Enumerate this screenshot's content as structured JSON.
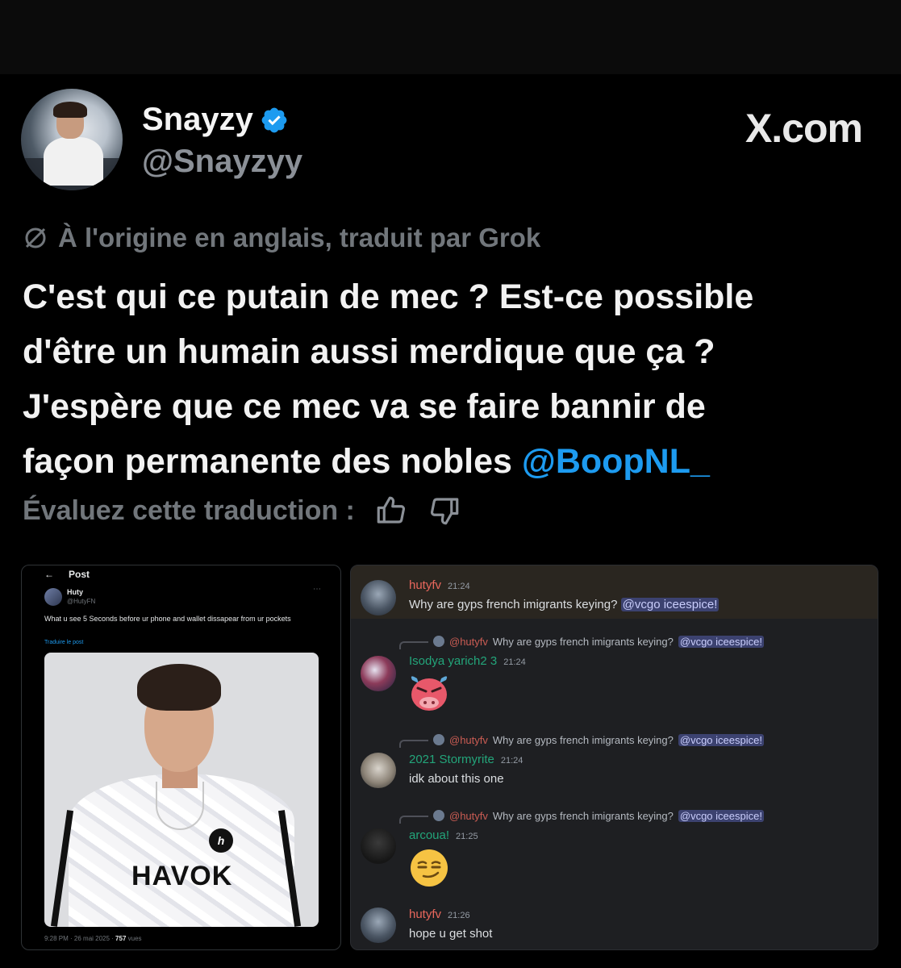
{
  "header": {
    "display_name": "Snayzy",
    "handle": "@Snayzyy",
    "brand": "X.com"
  },
  "translation": {
    "note": "À l'origine en anglais, traduit par Grok",
    "rate_label": "Évaluez cette traduction :"
  },
  "tweet": {
    "line1": "C'est qui ce putain de mec ? Est-ce possible",
    "line2": "d'être un humain aussi merdique que ça ?",
    "line3": "J'espère que ce mec va se faire bannir de",
    "line4": "façon permanente des nobles ",
    "mention": "@BoopNL_"
  },
  "embedded_post": {
    "bar_title": "Post",
    "author_name": "Huty",
    "author_handle": "@HutyFN",
    "text": "What u see 5 Seconds before ur phone and wallet dissapear from ur pockets",
    "translate_link": "Traduire le post",
    "photo_brand": "HAVOK",
    "footer_time": "9:28 PM · 26 mai 2025 · ",
    "footer_views": "757",
    "footer_views_label": " vues"
  },
  "discord": {
    "messages": [
      {
        "user": "hutyfv",
        "time": "21:24",
        "text": "Why are gyps french imigrants keying?",
        "mention": "@vcgo iceespice!"
      },
      {
        "reply_user": "@hutyfv",
        "reply_text": "Why are gyps french imigrants keying?",
        "reply_mention": "@vcgo iceespice!",
        "user": "Isodya yarich2 3",
        "time": "21:24",
        "emoji": "angry-cow-emoji"
      },
      {
        "reply_user": "@hutyfv",
        "reply_text": "Why are gyps french imigrants keying?",
        "reply_mention": "@vcgo iceespice!",
        "user": "2021 Stormyrite",
        "time": "21:24",
        "text": "idk about this one"
      },
      {
        "reply_user": "@hutyfv",
        "reply_text": "Why are gyps french imigrants keying?",
        "reply_mention": "@vcgo iceespice!",
        "user": "arcoua!",
        "time": "21:25",
        "emoji": "smirk-emoji"
      },
      {
        "user": "hutyfv",
        "time": "21:26",
        "text": "hope u get shot"
      }
    ]
  },
  "colors": {
    "background": "#000000",
    "mention_blue": "#1d9bf0",
    "verified_blue": "#1d9bf0",
    "muted": "#71767b",
    "discord_bg": "#1e1f22",
    "discord_red_user": "#e8675c",
    "discord_green_user": "#23a57a"
  },
  "icons": [
    "verified-badge-icon",
    "translate-slash-icon",
    "thumbs-up-icon",
    "thumbs-down-icon",
    "back-arrow-icon",
    "more-dots-icon"
  ]
}
